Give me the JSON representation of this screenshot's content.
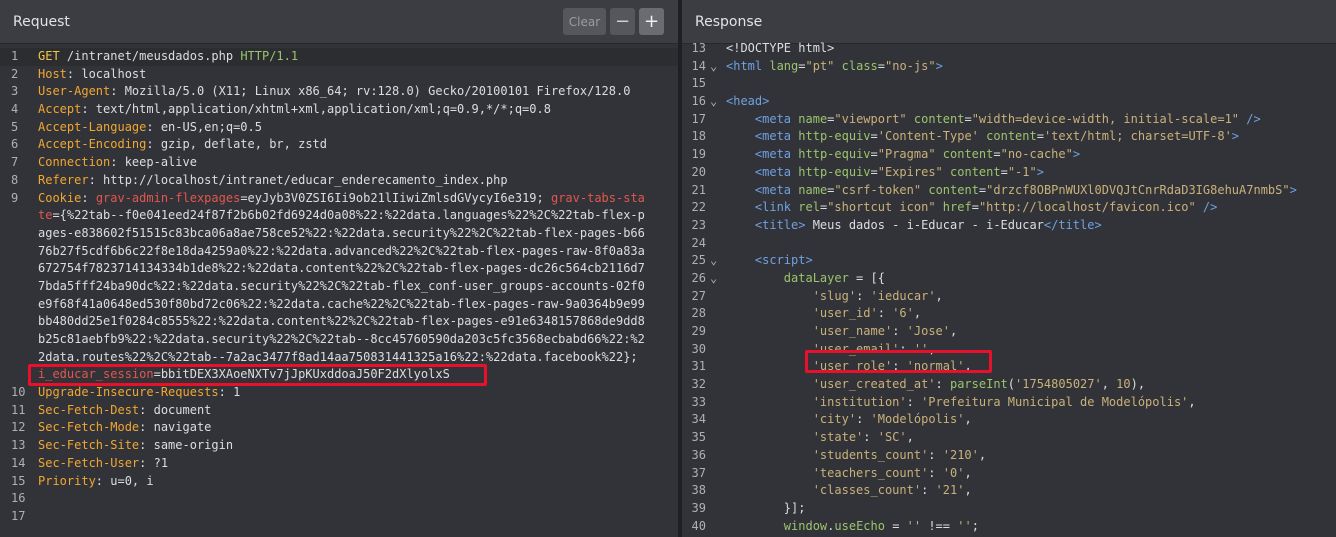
{
  "request": {
    "title": "Request",
    "buttons": {
      "clear": "Clear",
      "minus": "−",
      "plus": "+"
    },
    "lines": [
      {
        "n": "1",
        "parts": [
          [
            "meth",
            "GET"
          ],
          [
            "v",
            " /intranet/meusdados.php "
          ],
          [
            "proto",
            "HTTP/1.1"
          ]
        ]
      },
      {
        "n": "2",
        "parts": [
          [
            "k",
            "Host"
          ],
          [
            "v",
            ": localhost"
          ]
        ]
      },
      {
        "n": "3",
        "parts": [
          [
            "k",
            "User-Agent"
          ],
          [
            "v",
            ": Mozilla/5.0 (X11; Linux x86_64; rv:128.0) Gecko/20100101 Firefox/128.0"
          ]
        ]
      },
      {
        "n": "4",
        "parts": [
          [
            "k",
            "Accept"
          ],
          [
            "v",
            ": text/html,application/xhtml+xml,application/xml;q=0.9,*/*;q=0.8"
          ]
        ]
      },
      {
        "n": "5",
        "parts": [
          [
            "k",
            "Accept-Language"
          ],
          [
            "v",
            ": en-US,en;q=0.5"
          ]
        ]
      },
      {
        "n": "6",
        "parts": [
          [
            "k",
            "Accept-Encoding"
          ],
          [
            "v",
            ": gzip, deflate, br, zstd"
          ]
        ]
      },
      {
        "n": "7",
        "parts": [
          [
            "k",
            "Connection"
          ],
          [
            "v",
            ": keep-alive"
          ]
        ]
      },
      {
        "n": "8",
        "parts": [
          [
            "k",
            "Referer"
          ],
          [
            "v",
            ": http://localhost/intranet/educar_enderecamento_index.php"
          ]
        ]
      },
      {
        "n": "9",
        "parts": [
          [
            "k",
            "Cookie"
          ],
          [
            "v",
            ": "
          ],
          [
            "ck",
            "grav-admin-flexpages"
          ],
          [
            "v",
            "=eyJyb3V0ZSI6Ii9ob21lIiwiZmlsdGVycyI6e319; "
          ],
          [
            "ck",
            "grav-tabs-sta"
          ]
        ]
      },
      {
        "n": "",
        "parts": [
          [
            "ck",
            "te"
          ],
          [
            "v",
            "={%22tab--f0e041eed24f87f2b6b02fd6924d0a08%22:%22data.languages%22%2C%22tab-flex-p"
          ]
        ]
      },
      {
        "n": "",
        "parts": [
          [
            "v",
            "ages-e838602f51515c83bca06a8ae758ce52%22:%22data.security%22%2C%22tab-flex-pages-b66"
          ]
        ]
      },
      {
        "n": "",
        "parts": [
          [
            "v",
            "76b27f5cdf6b6c22f8e18da4259a0%22:%22data.advanced%22%2C%22tab-flex-pages-raw-8f0a83a"
          ]
        ]
      },
      {
        "n": "",
        "parts": [
          [
            "v",
            "672754f7823714134334b1de8%22:%22data.content%22%2C%22tab-flex-pages-dc26c564cb2116d7"
          ]
        ]
      },
      {
        "n": "",
        "parts": [
          [
            "v",
            "7bda5fff24ba90dc%22:%22data.security%22%2C%22tab-flex_conf-user_groups-accounts-02f0"
          ]
        ]
      },
      {
        "n": "",
        "parts": [
          [
            "v",
            "e9f68f41a0648ed530f80bd72c06%22:%22data.cache%22%2C%22tab-flex-pages-raw-9a0364b9e99"
          ]
        ]
      },
      {
        "n": "",
        "parts": [
          [
            "v",
            "bb480dd25e1f0284c8555%22:%22data.content%22%2C%22tab-flex-pages-e91e6348157868de9dd8"
          ]
        ]
      },
      {
        "n": "",
        "parts": [
          [
            "v",
            "b25c81aebfb9%22:%22data.security%22%2C%22tab--8cc45760590da203c5fc3568ecbabd66%22:%2"
          ]
        ]
      },
      {
        "n": "",
        "parts": [
          [
            "v",
            "2data.routes%22%2C%22tab--7a2ac3477f8ad14aa750831441325a16%22:%22data.facebook%22};"
          ]
        ]
      },
      {
        "n": "",
        "parts": [
          [
            "ck",
            "i_educar_session"
          ],
          [
            "v",
            "=bbitDEX3XAoeNXTv7jJpKUxddoaJ50F2dXlyolxS"
          ]
        ]
      },
      {
        "n": "10",
        "parts": [
          [
            "k",
            "Upgrade-Insecure-Requests"
          ],
          [
            "v",
            ": 1"
          ]
        ]
      },
      {
        "n": "11",
        "parts": [
          [
            "k",
            "Sec-Fetch-Dest"
          ],
          [
            "v",
            ": document"
          ]
        ]
      },
      {
        "n": "12",
        "parts": [
          [
            "k",
            "Sec-Fetch-Mode"
          ],
          [
            "v",
            ": navigate"
          ]
        ]
      },
      {
        "n": "13",
        "parts": [
          [
            "k",
            "Sec-Fetch-Site"
          ],
          [
            "v",
            ": same-origin"
          ]
        ]
      },
      {
        "n": "14",
        "parts": [
          [
            "k",
            "Sec-Fetch-User"
          ],
          [
            "v",
            ": ?1"
          ]
        ]
      },
      {
        "n": "15",
        "parts": [
          [
            "k",
            "Priority"
          ],
          [
            "v",
            ": u=0, i"
          ]
        ]
      },
      {
        "n": "16",
        "parts": []
      },
      {
        "n": "17",
        "parts": []
      }
    ]
  },
  "response": {
    "title": "Response",
    "lines": [
      {
        "n": "13",
        "f": "",
        "parts": [
          [
            "plain",
            "<!DOCTYPE html>"
          ]
        ]
      },
      {
        "n": "14",
        "f": "⌄",
        "parts": [
          [
            "tag",
            "<html "
          ],
          [
            "attr",
            "lang"
          ],
          [
            "plain",
            "="
          ],
          [
            "str",
            "\"pt\""
          ],
          [
            "plain",
            " "
          ],
          [
            "attr",
            "class"
          ],
          [
            "plain",
            "="
          ],
          [
            "str",
            "\"no-js\""
          ],
          [
            "tag",
            ">"
          ]
        ]
      },
      {
        "n": "15",
        "f": "",
        "parts": []
      },
      {
        "n": "16",
        "f": "⌄",
        "parts": [
          [
            "tag",
            "<head>"
          ]
        ]
      },
      {
        "n": "17",
        "f": "",
        "parts": [
          [
            "plain",
            "    "
          ],
          [
            "tag",
            "<meta "
          ],
          [
            "attr",
            "name"
          ],
          [
            "plain",
            "="
          ],
          [
            "str",
            "\"viewport\""
          ],
          [
            "plain",
            " "
          ],
          [
            "attr",
            "content"
          ],
          [
            "plain",
            "="
          ],
          [
            "str",
            "\"width=device-width, initial-scale=1\""
          ],
          [
            "plain",
            " "
          ],
          [
            "tag",
            "/>"
          ]
        ]
      },
      {
        "n": "18",
        "f": "",
        "parts": [
          [
            "plain",
            "    "
          ],
          [
            "tag",
            "<meta "
          ],
          [
            "attr",
            "http-equiv"
          ],
          [
            "plain",
            "="
          ],
          [
            "str",
            "'Content-Type'"
          ],
          [
            "plain",
            " "
          ],
          [
            "attr",
            "content"
          ],
          [
            "plain",
            "="
          ],
          [
            "str",
            "'text/html; charset=UTF-8'"
          ],
          [
            "tag",
            ">"
          ]
        ]
      },
      {
        "n": "19",
        "f": "",
        "parts": [
          [
            "plain",
            "    "
          ],
          [
            "tag",
            "<meta "
          ],
          [
            "attr",
            "http-equiv"
          ],
          [
            "plain",
            "="
          ],
          [
            "str",
            "\"Pragma\""
          ],
          [
            "plain",
            " "
          ],
          [
            "attr",
            "content"
          ],
          [
            "plain",
            "="
          ],
          [
            "str",
            "\"no-cache\""
          ],
          [
            "tag",
            ">"
          ]
        ]
      },
      {
        "n": "20",
        "f": "",
        "parts": [
          [
            "plain",
            "    "
          ],
          [
            "tag",
            "<meta "
          ],
          [
            "attr",
            "http-equiv"
          ],
          [
            "plain",
            "="
          ],
          [
            "str",
            "\"Expires\""
          ],
          [
            "plain",
            " "
          ],
          [
            "attr",
            "content"
          ],
          [
            "plain",
            "="
          ],
          [
            "str",
            "\"-1\""
          ],
          [
            "tag",
            ">"
          ]
        ]
      },
      {
        "n": "21",
        "f": "",
        "parts": [
          [
            "plain",
            "    "
          ],
          [
            "tag",
            "<meta "
          ],
          [
            "attr",
            "name"
          ],
          [
            "plain",
            "="
          ],
          [
            "str",
            "\"csrf-token\""
          ],
          [
            "plain",
            " "
          ],
          [
            "attr",
            "content"
          ],
          [
            "plain",
            "="
          ],
          [
            "str",
            "\"drzcf8OBPnWUXl0DVQJtCnrRdaD3IG8ehuA7nmbS\""
          ],
          [
            "tag",
            ">"
          ]
        ]
      },
      {
        "n": "22",
        "f": "",
        "parts": [
          [
            "plain",
            "    "
          ],
          [
            "tag",
            "<link "
          ],
          [
            "attr",
            "rel"
          ],
          [
            "plain",
            "="
          ],
          [
            "str",
            "\"shortcut icon\""
          ],
          [
            "plain",
            " "
          ],
          [
            "attr",
            "href"
          ],
          [
            "plain",
            "="
          ],
          [
            "str",
            "\"http://localhost/favicon.ico\""
          ],
          [
            "plain",
            " "
          ],
          [
            "tag",
            "/>"
          ]
        ]
      },
      {
        "n": "23",
        "f": "",
        "parts": [
          [
            "plain",
            "    "
          ],
          [
            "tag",
            "<title>"
          ],
          [
            "plain",
            " Meus dados - i-Educar - i-Educar"
          ],
          [
            "tag",
            "</title>"
          ]
        ]
      },
      {
        "n": "24",
        "f": "",
        "parts": []
      },
      {
        "n": "25",
        "f": "⌄",
        "parts": [
          [
            "plain",
            "    "
          ],
          [
            "tag",
            "<script>"
          ]
        ]
      },
      {
        "n": "26",
        "f": "⌄",
        "parts": [
          [
            "plain",
            "        "
          ],
          [
            "fn",
            "dataLayer"
          ],
          [
            "plain",
            " = [{"
          ]
        ]
      },
      {
        "n": "27",
        "f": "",
        "parts": [
          [
            "plain",
            "            "
          ],
          [
            "key",
            "'slug'"
          ],
          [
            "plain",
            ": "
          ],
          [
            "str",
            "'ieducar'"
          ],
          [
            "plain",
            ","
          ]
        ]
      },
      {
        "n": "28",
        "f": "",
        "parts": [
          [
            "plain",
            "            "
          ],
          [
            "key",
            "'user_id'"
          ],
          [
            "plain",
            ": "
          ],
          [
            "str",
            "'6'"
          ],
          [
            "plain",
            ","
          ]
        ]
      },
      {
        "n": "29",
        "f": "",
        "parts": [
          [
            "plain",
            "            "
          ],
          [
            "key",
            "'user_name'"
          ],
          [
            "plain",
            ": "
          ],
          [
            "str",
            "'Jose'"
          ],
          [
            "plain",
            ","
          ]
        ]
      },
      {
        "n": "30",
        "f": "",
        "parts": [
          [
            "plain",
            "            "
          ],
          [
            "key",
            "'user_email'"
          ],
          [
            "plain",
            ": "
          ],
          [
            "str",
            "''"
          ],
          [
            "plain",
            ","
          ]
        ]
      },
      {
        "n": "31",
        "f": "",
        "parts": [
          [
            "plain",
            "            "
          ],
          [
            "key",
            "'user_role'"
          ],
          [
            "plain",
            ": "
          ],
          [
            "str",
            "'normal'"
          ],
          [
            "plain",
            ","
          ]
        ]
      },
      {
        "n": "32",
        "f": "",
        "parts": [
          [
            "plain",
            "            "
          ],
          [
            "key",
            "'user_created_at'"
          ],
          [
            "plain",
            ": "
          ],
          [
            "fn",
            "parseInt"
          ],
          [
            "plain",
            "("
          ],
          [
            "str",
            "'1754805027'"
          ],
          [
            "plain",
            ", "
          ],
          [
            "num",
            "10"
          ],
          [
            "plain",
            "),"
          ]
        ]
      },
      {
        "n": "33",
        "f": "",
        "parts": [
          [
            "plain",
            "            "
          ],
          [
            "key",
            "'institution'"
          ],
          [
            "plain",
            ": "
          ],
          [
            "str",
            "'Prefeitura Municipal de Modelópolis'"
          ],
          [
            "plain",
            ","
          ]
        ]
      },
      {
        "n": "34",
        "f": "",
        "parts": [
          [
            "plain",
            "            "
          ],
          [
            "key",
            "'city'"
          ],
          [
            "plain",
            ": "
          ],
          [
            "str",
            "'Modelópolis'"
          ],
          [
            "plain",
            ","
          ]
        ]
      },
      {
        "n": "35",
        "f": "",
        "parts": [
          [
            "plain",
            "            "
          ],
          [
            "key",
            "'state'"
          ],
          [
            "plain",
            ": "
          ],
          [
            "str",
            "'SC'"
          ],
          [
            "plain",
            ","
          ]
        ]
      },
      {
        "n": "36",
        "f": "",
        "parts": [
          [
            "plain",
            "            "
          ],
          [
            "key",
            "'students_count'"
          ],
          [
            "plain",
            ": "
          ],
          [
            "str",
            "'210'"
          ],
          [
            "plain",
            ","
          ]
        ]
      },
      {
        "n": "37",
        "f": "",
        "parts": [
          [
            "plain",
            "            "
          ],
          [
            "key",
            "'teachers_count'"
          ],
          [
            "plain",
            ": "
          ],
          [
            "str",
            "'0'"
          ],
          [
            "plain",
            ","
          ]
        ]
      },
      {
        "n": "38",
        "f": "",
        "parts": [
          [
            "plain",
            "            "
          ],
          [
            "key",
            "'classes_count'"
          ],
          [
            "plain",
            ": "
          ],
          [
            "str",
            "'21'"
          ],
          [
            "plain",
            ","
          ]
        ]
      },
      {
        "n": "39",
        "f": "",
        "parts": [
          [
            "plain",
            "        }];"
          ]
        ]
      },
      {
        "n": "40",
        "f": "",
        "parts": [
          [
            "plain",
            "        "
          ],
          [
            "fn",
            "window"
          ],
          [
            "plain",
            "."
          ],
          [
            "fn",
            "useEcho"
          ],
          [
            "plain",
            " = "
          ],
          [
            "str",
            "''"
          ],
          [
            "plain",
            " !== "
          ],
          [
            "str",
            "''"
          ],
          [
            "plain",
            ";"
          ]
        ]
      }
    ]
  }
}
